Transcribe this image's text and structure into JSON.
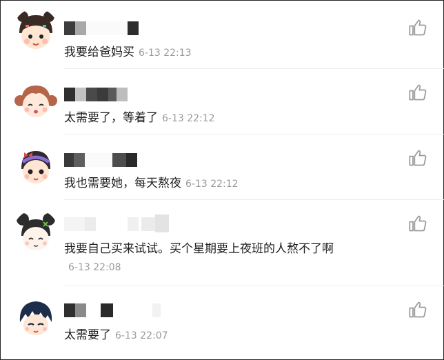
{
  "comments": [
    {
      "text": "我要给爸妈买",
      "time": "6-13 22:13"
    },
    {
      "text": "太需要了，等着了",
      "time": "6-13 22:12"
    },
    {
      "text": "我也需要她，每天熬夜",
      "time": "6-13 22:12"
    },
    {
      "text": "我要自己买来试试。买个星期要上夜班的人熬不了啊",
      "time": "6-13 22:08"
    },
    {
      "text": "太需要了",
      "time": "6-13 22:07"
    }
  ],
  "icons": {
    "like": "thumbs-up-icon",
    "avatar": "avatar-cartoon"
  }
}
